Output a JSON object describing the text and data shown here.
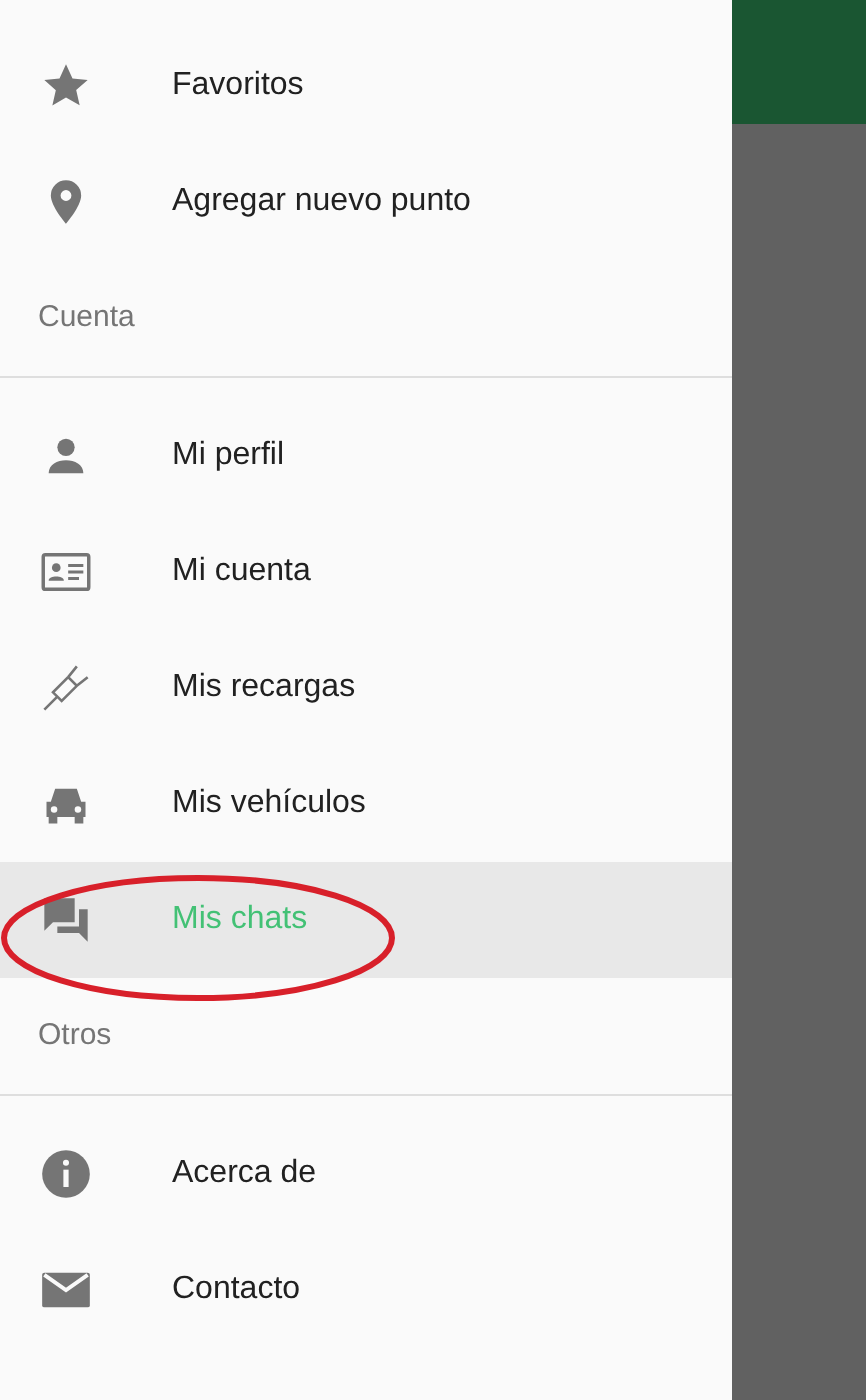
{
  "drawer": {
    "sections": [
      {
        "items": [
          {
            "label": "Favoritos",
            "selected": false
          },
          {
            "label": "Agregar nuevo punto",
            "selected": false
          }
        ]
      },
      {
        "header": "Cuenta",
        "items": [
          {
            "label": "Mi perfil",
            "selected": false
          },
          {
            "label": "Mi cuenta",
            "selected": false
          },
          {
            "label": "Mis recargas",
            "selected": false
          },
          {
            "label": "Mis vehículos",
            "selected": false
          },
          {
            "label": "Mis chats",
            "selected": true
          }
        ]
      },
      {
        "header": "Otros",
        "items": [
          {
            "label": "Acerca de",
            "selected": false
          },
          {
            "label": "Contacto",
            "selected": false
          }
        ]
      }
    ]
  }
}
